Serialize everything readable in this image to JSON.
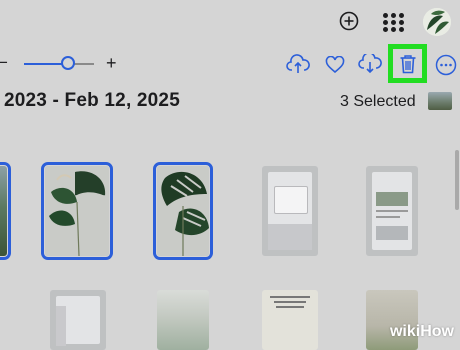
{
  "toolbar": {
    "date_range": "2023 - Feb 12, 2025",
    "selected_text": "3 Selected",
    "zoom_minus": "−",
    "zoom_plus": "+",
    "zoom_level": 0.6
  },
  "colors": {
    "accent": "#2c5fd9",
    "highlight": "#22dd22",
    "background": "#d5d5d5"
  },
  "icons": [
    "add-icon",
    "apps-grid-icon",
    "avatar",
    "upload-icon",
    "heart-icon",
    "download-icon",
    "trash-icon",
    "more-icon"
  ],
  "photos": [
    {
      "kind": "landscape",
      "selected": true
    },
    {
      "kind": "monstera",
      "selected": true
    },
    {
      "kind": "monstera",
      "selected": true
    },
    {
      "kind": "phone-screenshot",
      "selected": false
    },
    {
      "kind": "phone-screenshot",
      "selected": false
    },
    {
      "kind": "phone-screenshot",
      "selected": false
    },
    {
      "kind": "misty-forest",
      "selected": false
    },
    {
      "kind": "quote-card",
      "selected": false
    },
    {
      "kind": "poster",
      "selected": false
    }
  ],
  "watermark": {
    "w": "wiki",
    "h": "How"
  }
}
